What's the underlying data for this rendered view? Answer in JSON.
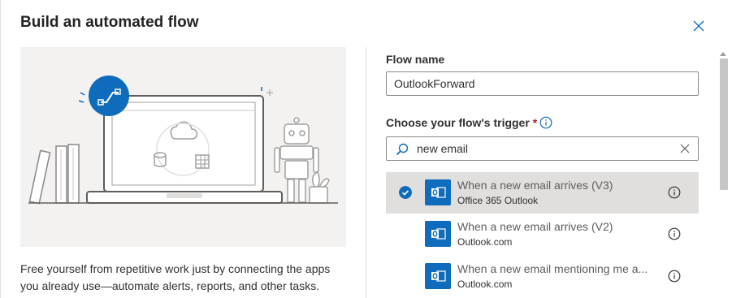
{
  "dialog": {
    "title": "Build an automated flow",
    "description": "Free yourself from repetitive work just by connecting the apps you already use—automate alerts, reports, and other tasks."
  },
  "form": {
    "flow_name_label": "Flow name",
    "flow_name_value": "OutlookForward",
    "trigger_label": "Choose your flow's trigger",
    "required_mark": "*",
    "search_value": "new email"
  },
  "triggers": [
    {
      "name": "When a new email arrives (V3)",
      "connector": "Office 365 Outlook",
      "selected": true
    },
    {
      "name": "When a new email arrives (V2)",
      "connector": "Outlook.com",
      "selected": false
    },
    {
      "name": "When a new email mentioning me a...",
      "connector": "Outlook.com",
      "selected": false
    }
  ],
  "colors": {
    "accent": "#0f6cbd",
    "selected_row": "#e1dfdd",
    "required": "#a4262c"
  },
  "icons": {
    "close": "close-icon",
    "info": "info-icon",
    "search": "search-icon",
    "clear": "clear-icon",
    "check": "check-circle-icon",
    "outlook": "outlook-icon"
  }
}
